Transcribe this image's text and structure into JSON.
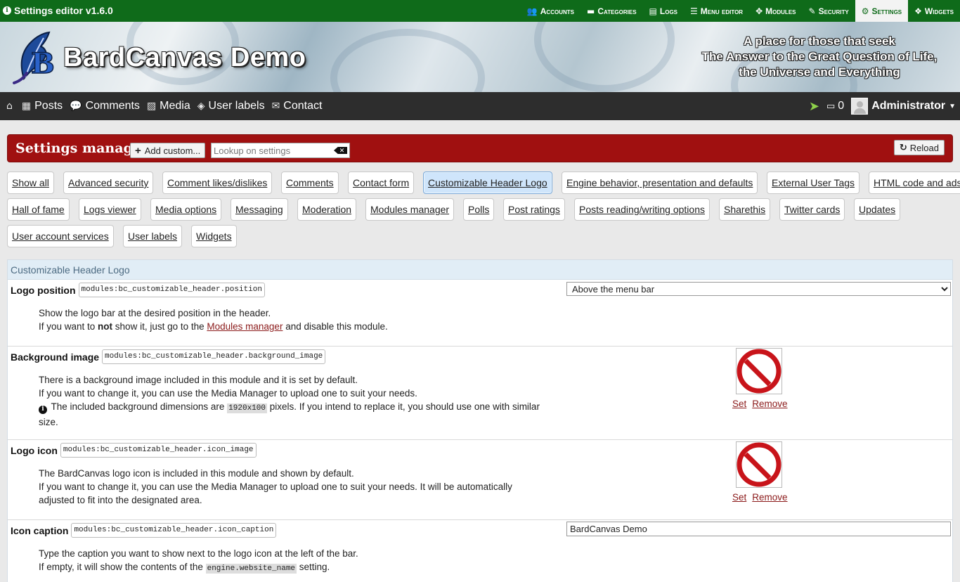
{
  "admin_bar": {
    "title": "Settings editor v1.6.0",
    "nav": [
      {
        "label": "Accounts",
        "icon": "users-icon",
        "glyph": "👥"
      },
      {
        "label": "Categories",
        "icon": "folder-icon",
        "glyph": "▬"
      },
      {
        "label": "Logs",
        "icon": "file-icon",
        "glyph": "▤"
      },
      {
        "label": "Menu editor",
        "icon": "bars-icon",
        "glyph": "☰"
      },
      {
        "label": "Modules",
        "icon": "puzzle-icon",
        "glyph": "✥"
      },
      {
        "label": "Security",
        "icon": "fire-extinguisher-icon",
        "glyph": "✎"
      },
      {
        "label": "Settings",
        "icon": "cogs-icon",
        "glyph": "⚙",
        "active": true
      },
      {
        "label": "Widgets",
        "icon": "cubes-icon",
        "glyph": "❖"
      }
    ]
  },
  "banner": {
    "caption": "BardCanvas Demo",
    "tagline_1": "A place for those that seek",
    "tagline_2": "The Answer to the Great Question of Life,",
    "tagline_3": "the Universe and Everything"
  },
  "main_menu": {
    "items": [
      {
        "label": "",
        "icon": "home-icon",
        "glyph": "⌂"
      },
      {
        "label": "Posts",
        "icon": "newspaper-icon",
        "glyph": "▦"
      },
      {
        "label": "Comments",
        "icon": "comments-icon",
        "glyph": "💬"
      },
      {
        "label": "Media",
        "icon": "picture-icon",
        "glyph": "▨"
      },
      {
        "label": "User labels",
        "icon": "tags-icon",
        "glyph": "◈"
      },
      {
        "label": "Contact",
        "icon": "envelope-icon",
        "glyph": "✉"
      }
    ],
    "inbox_count": "0",
    "user_name": "Administrator"
  },
  "settings_bar": {
    "heading": "Settings manager",
    "add_custom_label": "Add custom...",
    "lookup_placeholder": "Lookup on settings",
    "reload_label": "Reload"
  },
  "groups": {
    "rows": [
      [
        "Show all",
        "Advanced security",
        "Comment likes/dislikes",
        "Comments",
        "Contact form",
        "Customizable Header Logo",
        "Engine behavior, presentation and defaults",
        "External User Tags",
        "HTML code and ads injection"
      ],
      [
        "Hall of fame",
        "Logs viewer",
        "Media options",
        "Messaging",
        "Moderation",
        "Modules manager",
        "Polls",
        "Post ratings",
        "Posts reading/writing options",
        "Sharethis",
        "Twitter cards",
        "Updates"
      ],
      [
        "User account services",
        "User labels",
        "Widgets"
      ]
    ],
    "active": "Customizable Header Logo"
  },
  "panel": {
    "title": "Customizable Header Logo",
    "settings": {
      "position": {
        "name": "Logo position",
        "key": "modules:bc_customizable_header.position",
        "value": "Above the menu bar",
        "desc_1": "Show the logo bar at the desired position in the header.",
        "desc_2_pre": "If you want to ",
        "desc_2_bold": "not",
        "desc_2_mid": " show it, just go to the ",
        "desc_2_link": "Modules manager",
        "desc_2_post": " and disable this module."
      },
      "background_image": {
        "name": "Background image",
        "key": "modules:bc_customizable_header.background_image",
        "desc_1": "There is a background image included in this module and it is set by default.",
        "desc_2": "If you want to change it, you can use the Media Manager to upload one to suit your needs.",
        "desc_3_pre": " The included background dimensions are ",
        "desc_3_code": "1920x100",
        "desc_3_post": " pixels. If you intend to replace it, you should use one with similar size.",
        "set_label": "Set",
        "remove_label": "Remove"
      },
      "icon_image": {
        "name": "Logo icon",
        "key": "modules:bc_customizable_header.icon_image",
        "desc_1": "The BardCanvas logo icon is included in this module and shown by default.",
        "desc_2": "If you want to change it, you can use the Media Manager to upload one to suit your needs. It will be automatically adjusted to fit into the designated area.",
        "set_label": "Set",
        "remove_label": "Remove"
      },
      "icon_caption": {
        "name": "Icon caption",
        "key": "modules:bc_customizable_header.icon_caption",
        "value": "BardCanvas Demo",
        "desc_1": "Type the caption you want to show next to the logo icon at the left of the bar.",
        "desc_2_pre": "If empty, it will show the contents of the ",
        "desc_2_code": "engine.website_name",
        "desc_2_post": " setting."
      }
    }
  }
}
